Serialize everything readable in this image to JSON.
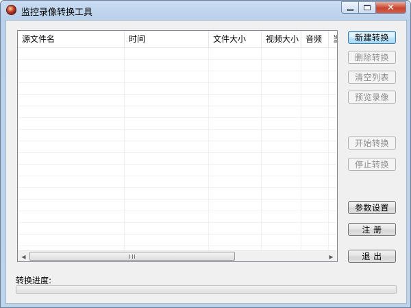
{
  "window": {
    "title": "监控录像转换工具",
    "close_glyph": "✕"
  },
  "listview": {
    "columns": [
      "源文件名",
      "时间",
      "文件大小",
      "视频大小",
      "音频",
      "当"
    ],
    "rows": []
  },
  "buttons": {
    "new_convert": "新建转换",
    "delete_convert": "删除转换",
    "clear_list": "清空列表",
    "preview_video": "预览录像",
    "start_convert": "开始转换",
    "stop_convert": "停止转换",
    "settings": "参数设置",
    "register": "注 册",
    "exit": "退 出"
  },
  "progress": {
    "label": "转换进度:",
    "value": 0
  },
  "scrollbar": {
    "left_arrow": "◀",
    "right_arrow": "▶"
  },
  "icons": [
    "app-icon",
    "minimize-icon",
    "maximize-icon",
    "close-icon",
    "scroll-left-arrow-icon",
    "scroll-right-arrow-icon"
  ]
}
